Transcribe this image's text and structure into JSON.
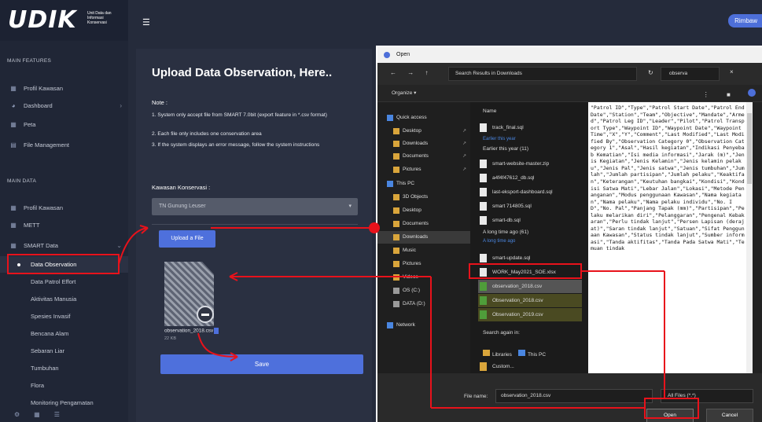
{
  "app": {
    "logo": "UDIK",
    "logo_sub": "Unit Data dan Informasi Konservasi",
    "menu_icon": "hamburger-icon",
    "user_button": "Rimbaw"
  },
  "sidebar": {
    "section_main": "MAIN FEATURES",
    "main_items": [
      {
        "label": "Profil Kawasan",
        "icon": "grid-icon"
      },
      {
        "label": "Dashboard",
        "icon": "dashboard-icon"
      },
      {
        "label": "Peta",
        "icon": "map-icon"
      },
      {
        "label": "File Management",
        "icon": "folder-icon"
      }
    ],
    "section_data": "MAIN DATA",
    "data_items": [
      {
        "label": "Profil Kawasan",
        "icon": "grid-icon"
      },
      {
        "label": "METT",
        "icon": "grid-icon"
      },
      {
        "label": "SMART Data",
        "icon": "grid-icon"
      }
    ],
    "sub_items": [
      "Data Observation",
      "Data Patrol Effort",
      "Aktivitas Manusia",
      "Spesies Invasif",
      "Bencana Alam",
      "Sebaran Liar",
      "Tumbuhan",
      "Flora",
      "Monitoring Pengamatan"
    ],
    "active_sub": "Data Observation"
  },
  "upload": {
    "title": "Upload Data Observation, Here..",
    "note_label": "Note :",
    "notes": [
      "1. System only accept file from SMART 7.0bit (export feature in *.csv format)",
      "2. Each file only includes one conservation area",
      "3. If the system displays an error message, follow the system instructions"
    ],
    "kawasan_label": "Kawasan Konservasi :",
    "kawasan_value": "TN Gunung Leuser",
    "upload_button": "Upload a File",
    "file_name": "observation_2018.csv",
    "file_size": "22 KB",
    "save_button": "Save"
  },
  "dialog": {
    "title": "Open",
    "nav_arrows": "← → ↑",
    "address": "Search Results in Downloads",
    "search_value": "observa",
    "organize": "Organize ▾",
    "nav_items": [
      {
        "label": "Quick access",
        "type": "star"
      },
      {
        "label": "Desktop",
        "type": "folder",
        "pin": true
      },
      {
        "label": "Downloads",
        "type": "folder",
        "pin": true
      },
      {
        "label": "Documents",
        "type": "folder",
        "pin": true
      },
      {
        "label": "Pictures",
        "type": "folder",
        "pin": true
      },
      {
        "label": "This PC",
        "type": "pc"
      },
      {
        "label": "3D Objects",
        "type": "folder"
      },
      {
        "label": "Desktop",
        "type": "folder"
      },
      {
        "label": "Documents",
        "type": "folder"
      },
      {
        "label": "Downloads",
        "type": "folder-sel"
      },
      {
        "label": "Music",
        "type": "folder"
      },
      {
        "label": "Pictures",
        "type": "folder"
      },
      {
        "label": "Videos",
        "type": "folder"
      },
      {
        "label": "OS (C:)",
        "type": "drive"
      },
      {
        "label": "DATA (D:)",
        "type": "drive"
      },
      {
        "label": "Network",
        "type": "net"
      }
    ],
    "col_header": "Name",
    "group_1": "Earlier this year (11)",
    "group_1_sub": "Earlier this year",
    "files_top": [
      "track_final.sql"
    ],
    "files_1": [
      "smart-website-master.zip",
      "a4f4f47612_db.sql",
      "last-eksport-dashboard.sql",
      "smart 714805.sql",
      "smart-db.sql"
    ],
    "group_2": "A long time ago (61)",
    "group_2_sub": "A long time ago",
    "files_2": [
      "smart-update.sql",
      "WORK_May2021_SOE.xlsx",
      "observation_2018.csv",
      "Observation_2018.csv",
      "Observation_2019.csv"
    ],
    "selected_file": "observation_2018.csv",
    "search_again": "Search again in:",
    "libraries": "Libraries",
    "this_pc": "This PC",
    "custom": "Custom...",
    "preview_text": "\"Patrol ID\",\"Type\",\"Patrol Start Date\",\"Patrol End Date\",\"Station\",\"Team\",\"Objective\",\"Mandate\",\"Armed\",\"Patrol Leg ID\",\"Leader\",\"Pilot\",\"Patrol Transport Type\",\"Waypoint ID\",\"Waypoint Date\",\"Waypoint Time\",\"X\",\"Y\",\"Comment\",\"Last Modified\",\"Last Modified By\",\"Observation Category 0\",\"Observation Category 1\",\"Asal\",\"Hasil kegiatan\",\"Indikasi Penyebab Kematian\",\"Isi media informasi\",\"Jarak (m)\",\"Jenis Kegiatan\",\"Jenis Kelamin\",\"Jenis kelamin pelaku\",\"Jenis Pal\",\"Jenis satwa\",\"Jenis tumbuhan\",\"Jumlah\",\"Jumlah partisipan\",\"Jumlah pelaku\",\"Keaktifan\",\"Keterangan\",\"Keutuhan bangkai\",\"Kondisi\",\"Kondisi Satwa Mati\",\"Lebar Jalan\",\"Lokasi\",\"Metode Penanganan\",\"Modus penggunaan Kawasan\",\"Nama kegiatan\",\"Nama pelaku\",\"Nama pelaku individu\",\"No. ID\",\"No. Pal\",\"Panjang Tapak (mm)\",\"Partisipan\",\"Pelaku melarikan diri\",\"Pelanggaran\",\"Pengenal Kebakaran\",\"Perlu tindak lanjut\",\"Persen Lapisan (derajat)\",\"Saran tindak lanjut\",\"Satuan\",\"Sifat Penggunaan Kawasan\",\"Status tindak lanjut\",\"Sumber informasi\",\"Tanda aktifitas\",\"Tanda Pada Satwa Mati\",\"Temuan tindak",
    "file_name_label": "File name:",
    "file_name_value": "observation_2018.csv",
    "file_type": "All Files (*.*)",
    "open_button": "Open",
    "cancel_button": "Cancel"
  },
  "colors": {
    "accent": "#4e70dc",
    "annotation": "#e8121b",
    "sidebar_bg": "#202636",
    "main_bg": "#252b3b"
  }
}
